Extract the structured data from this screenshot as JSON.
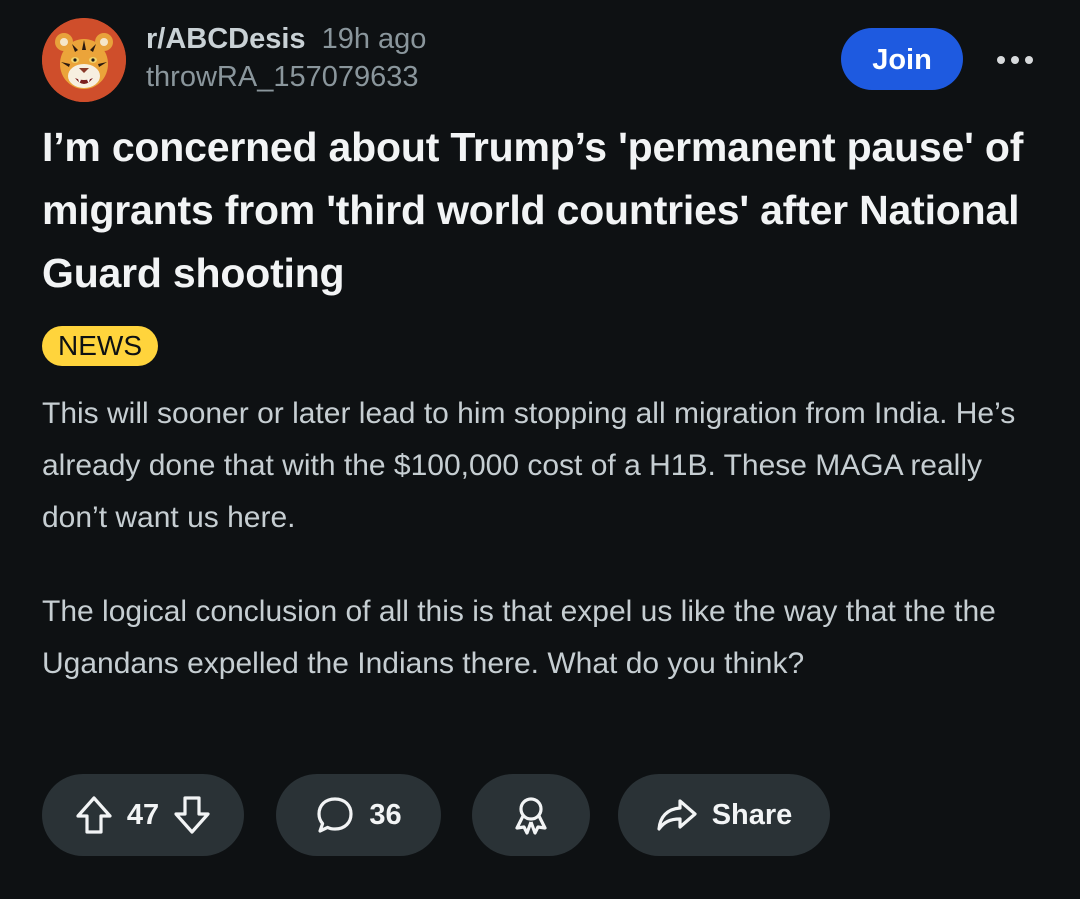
{
  "post": {
    "subreddit": "r/ABCDesis",
    "time_ago": "19h ago",
    "username": "throwRA_157079633",
    "join_label": "Join",
    "title": "I’m concerned about Trump’s 'permanent pause' of migrants from 'third world countries' after National Guard shooting",
    "flair": "NEWS",
    "body": [
      "This will sooner or later lead to him stopping all migration from India. He’s already done that with the $100,000 cost of a H1B. These MAGA really don’t want us here.",
      "The logical conclusion of all this is that expel us like the way that the the Ugandans expelled the Indians there. What do you think?"
    ]
  },
  "actions": {
    "vote_count": "47",
    "comment_count": "36",
    "share_label": "Share"
  },
  "icons": {
    "avatar": "tiger-avatar-icon",
    "more": "more-options-icon",
    "upvote": "upvote-arrow-icon",
    "downvote": "downvote-arrow-icon",
    "comment": "comment-bubble-icon",
    "award": "award-ribbon-icon",
    "share": "share-arrow-icon"
  },
  "colors": {
    "background": "#0e1113",
    "join_button": "#1e5ae0",
    "flair_background": "#ffd43c",
    "pill_background": "#2a3236",
    "avatar_background": "#cf4e2b"
  }
}
